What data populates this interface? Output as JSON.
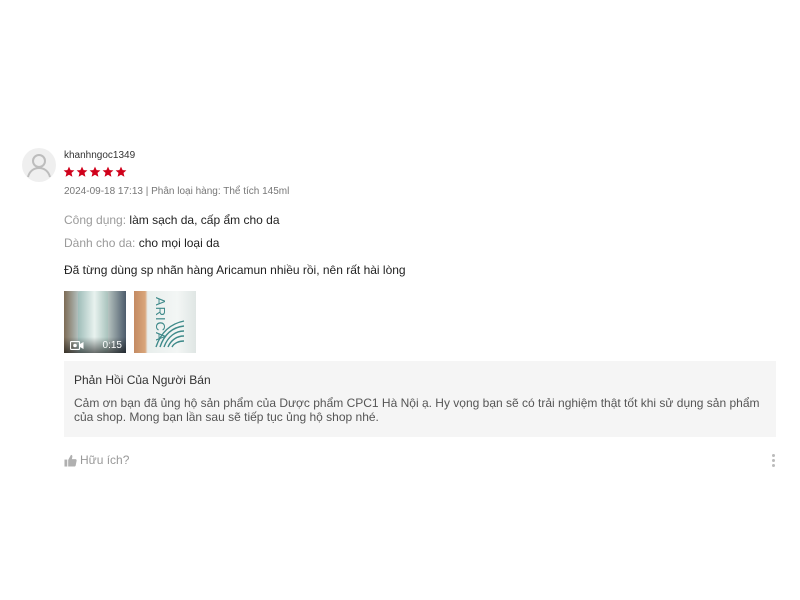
{
  "review": {
    "username": "khanhngoc1349",
    "rating": 5,
    "rating_max": 5,
    "star_color": "#d0011b",
    "meta": "2024-09-18 17:13 | Phân loại hàng: Thể tích 145ml",
    "attributes": [
      {
        "label": "Công dụng:",
        "value": "làm sạch da, cấp ẩm cho da"
      },
      {
        "label": "Dành cho da:",
        "value": "cho mọi loại da"
      }
    ],
    "body": "Đã từng dùng sp nhãn hàng Aricamun nhiều rồi, nên rất hài lòng",
    "media": [
      {
        "type": "video",
        "duration": "0:15",
        "icon": "video-camera-icon"
      },
      {
        "type": "photo",
        "brand_text": "ARICA"
      }
    ],
    "seller_reply": {
      "title": "Phản Hồi Của Người Bán",
      "text": "Cảm ơn bạn đã ủng hộ sản phẩm của Dược phẩm CPC1 Hà Nội ạ. Hy vọng bạn sẽ có trải nghiệm thật tốt khi sử dụng sản phẩm của shop. Mong bạn lần sau sẽ tiếp tục ủng hộ shop nhé."
    },
    "helpful_label": "Hữu ích?",
    "icons": {
      "avatar": "user-avatar-icon",
      "helpful": "thumbs-up-icon",
      "more": "more-vertical-icon"
    }
  }
}
